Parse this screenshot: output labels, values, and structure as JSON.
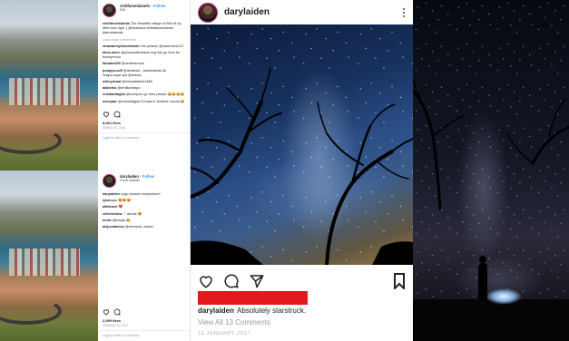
{
  "cards": [
    {
      "username": "visitfaroeislands",
      "follow_label": "Follow",
      "location": "Eiði",
      "caption_user": "visitfaroeislands",
      "caption_text": "The beautiful village of Eiði hit by afternoon light. | @visiolarsn #visitfaroeislands #faroeislands",
      "load_more": "Load more comments",
      "comments": [
        {
          "user": "strawberryblondeluiah",
          "text": "Yes please! @cashrules213"
        },
        {
          "user": "klina.omer",
          "text": "@jolumusilimtravel svg lets go here for honeymoon"
        },
        {
          "user": "fahadm000",
          "text": "@vertimerman"
        },
        {
          "user": "poopyscruff",
          "text": "@lbmfeute ..faroeislands Idi Stajus.topal nya @mania.."
        },
        {
          "user": "mikeyrmad",
          "text": "@miissabtarrie1860"
        },
        {
          "user": "akibertiz",
          "text": "@emiltardrapu"
        },
        {
          "user": "cristianttaglia",
          "text": "@everyoor go here please 😂😂😂😂"
        },
        {
          "user": "overyaar",
          "text": "@cristiuttaglia if it was in Iceland i would 😂"
        }
      ],
      "likes": "8,062 likes",
      "date": "MARCH 30, 2018",
      "login_prefix": "Log in",
      "login_suffix": "to like or comment."
    },
    {
      "username": "darylaiden",
      "follow_label": "Follow",
      "location": "Faroe Islands",
      "caption_user": "darylaiden",
      "caption_text": "Lego houses everywhere!",
      "comments": [
        {
          "user": "lylam.a.c",
          "text": "😍😍😍"
        },
        {
          "user": "allittemel",
          "text": "❤️"
        },
        {
          "user": "velvetvelina",
          "text": "♡ amour 😍"
        },
        {
          "user": "mrmt",
          "text": "@linkaja 😂"
        },
        {
          "user": "alejovalarezo",
          "text": "@bernarlin_isabel"
        }
      ],
      "likes": "2,599 likes",
      "date": "JANUARY 31, 2017",
      "login_prefix": "Log in",
      "login_suffix": "to like or comment."
    }
  ],
  "post": {
    "username": "darylaiden",
    "caption_user": "darylaiden",
    "caption_text": "Absolutely starstruck.",
    "view_all": "View All 13 Comments",
    "date": "11 JANUARY 2017"
  },
  "colors": {
    "link_blue": "#3897f0",
    "redact_red": "#e2181c",
    "text_dark": "#222222",
    "text_muted": "#999999"
  },
  "icons": [
    "heart-icon",
    "comment-icon",
    "share-icon",
    "bookmark-icon",
    "more-options-icon"
  ]
}
